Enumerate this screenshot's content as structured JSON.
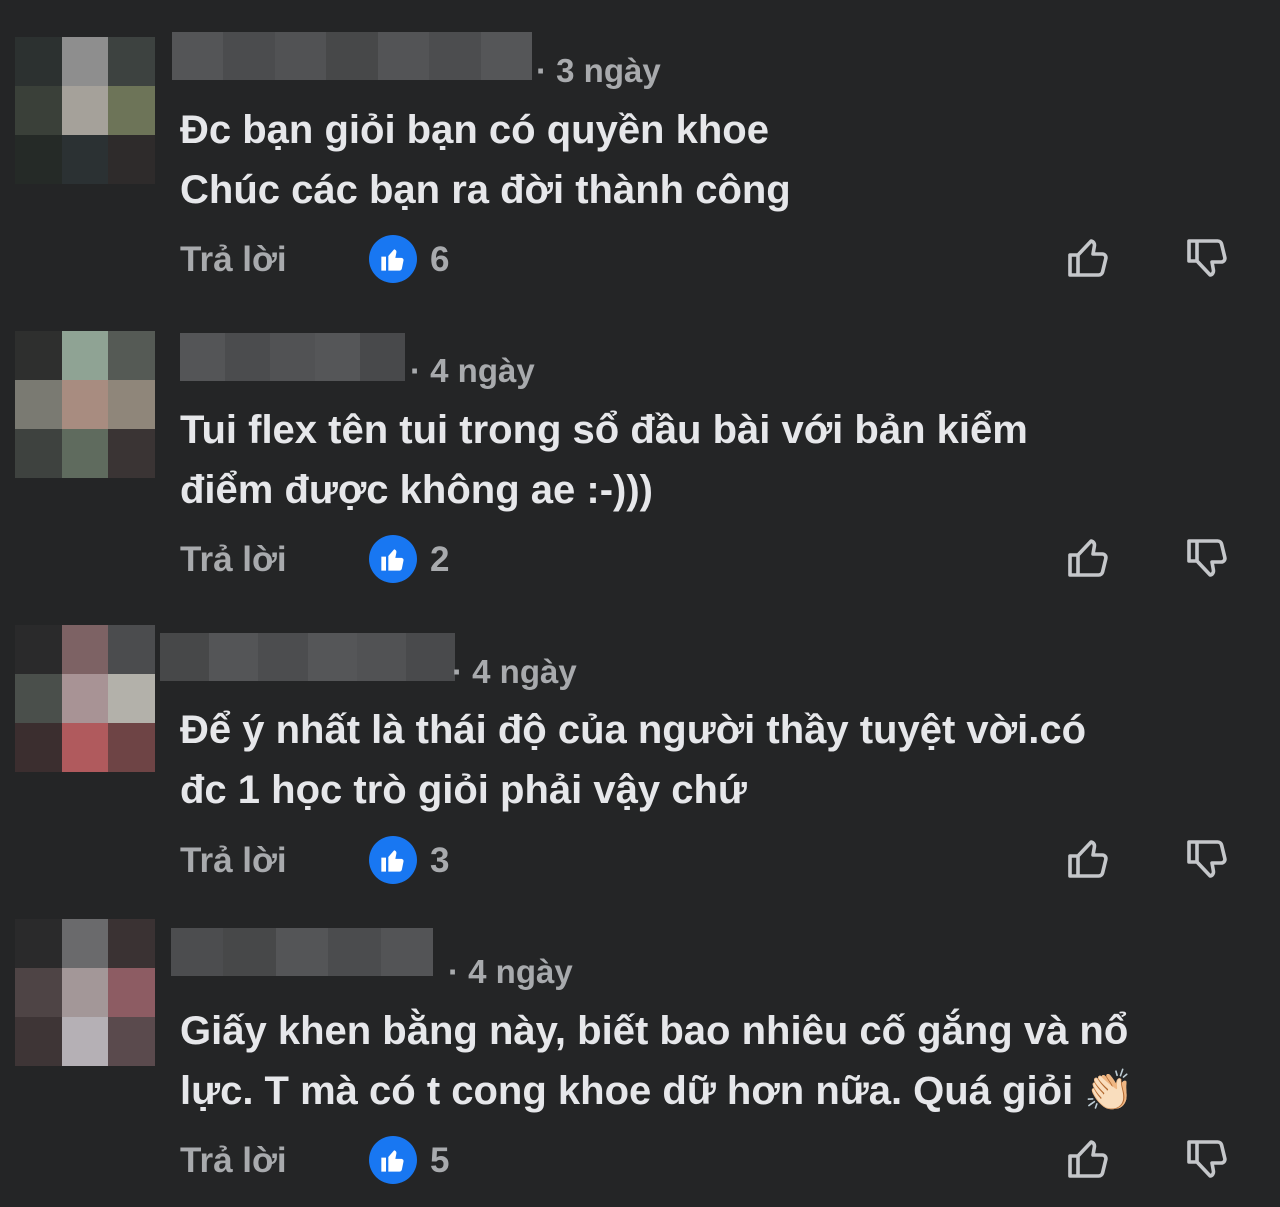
{
  "colors": {
    "background": "#242526",
    "text_primary": "#e6e7ea",
    "text_secondary": "#a8aaad",
    "like_blue": "#1877f2"
  },
  "icons": {
    "like_badge": "thumbs-up-filled-icon",
    "vote_up": "thumbs-up-outline-icon",
    "vote_down": "thumbs-down-outline-icon",
    "clap": "clapping-hands-emoji"
  },
  "comments": [
    {
      "time": "· 3 ngày",
      "lines": [
        "Đc bạn giỏi bạn có quyền khoe",
        "Chúc các bạn ra đời thành công"
      ],
      "reply_label": "Trả lời",
      "like_count": "6"
    },
    {
      "time": "· 4 ngày",
      "lines": [
        "Tui flex tên tui trong sổ đầu bài với bản kiểm",
        "điểm được không ae :-)))"
      ],
      "reply_label": "Trả lời",
      "like_count": "2"
    },
    {
      "time": "· 4 ngày",
      "lines": [
        "Để ý nhất là thái độ của người thầy tuyệt vời.có",
        "đc 1 học trò giỏi phải vậy chứ"
      ],
      "reply_label": "Trả lời",
      "like_count": "3"
    },
    {
      "time": "· 4 ngày",
      "lines": [
        "Giấy khen bằng này, biết bao nhiêu cố gắng và nổ",
        "lực. T mà có t cong khoe dữ hơn nữa. Quá giỏi"
      ],
      "emoji": "👏🏻",
      "reply_label": "Trả lời",
      "like_count": "5"
    }
  ]
}
